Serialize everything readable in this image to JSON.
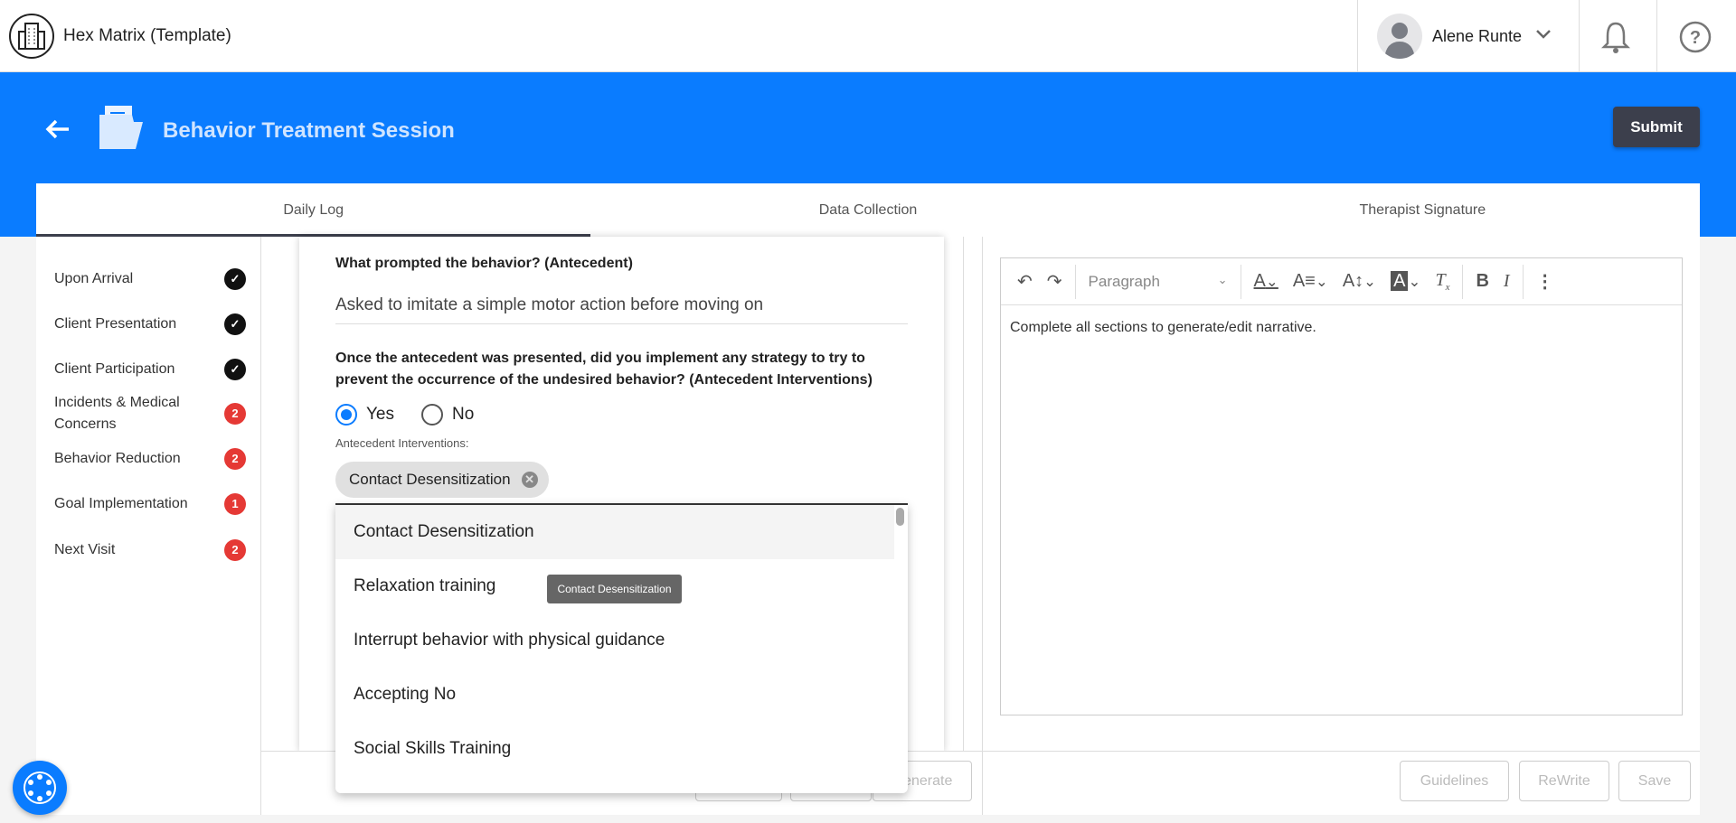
{
  "app": {
    "name": "Hex Matrix (Template)"
  },
  "user": {
    "name": "Alene Runte"
  },
  "header": {
    "title": "Behavior Treatment Session",
    "submit_label": "Submit"
  },
  "tabs": [
    {
      "label": "Daily Log",
      "active": true
    },
    {
      "label": "Data Collection"
    },
    {
      "label": "Therapist Signature"
    }
  ],
  "sidebar": {
    "items": [
      {
        "label": "Upon Arrival",
        "status": "complete"
      },
      {
        "label": "Client Presentation",
        "status": "complete"
      },
      {
        "label": "Client Participation",
        "status": "complete"
      },
      {
        "label": "Incidents & Medical Concerns",
        "badge": "2"
      },
      {
        "label": "Behavior Reduction",
        "badge": "2"
      },
      {
        "label": "Goal Implementation",
        "badge": "1"
      },
      {
        "label": "Next Visit",
        "badge": "2"
      }
    ]
  },
  "form": {
    "q1": "What prompted the behavior? (Antecedent)",
    "a1": "Asked to imitate a simple motor action before moving on",
    "q2": "Once the antecedent was presented, did you implement any strategy to try to prevent the occurrence of the undesired behavior? (Antecedent Interventions)",
    "radio_yes": "Yes",
    "radio_no": "No",
    "selected": "Yes",
    "field_label": "Antecedent Interventions:",
    "chip": "Contact Desensitization",
    "options": [
      "Contact Desensitization",
      "Relaxation training",
      "Interrupt behavior with physical guidance",
      "Accepting No",
      "Social Skills Training"
    ],
    "tooltip": "Contact Desensitization",
    "generate_label": "Generate"
  },
  "editor": {
    "paragraph_select": "Paragraph",
    "content": "Complete all sections to generate/edit narrative.",
    "buttons": {
      "guidelines": "Guidelines",
      "rewrite": "ReWrite",
      "save": "Save"
    }
  },
  "colors": {
    "brand": "#0a7cff",
    "badge": "#e53935",
    "submit": "#3c3f4c"
  }
}
